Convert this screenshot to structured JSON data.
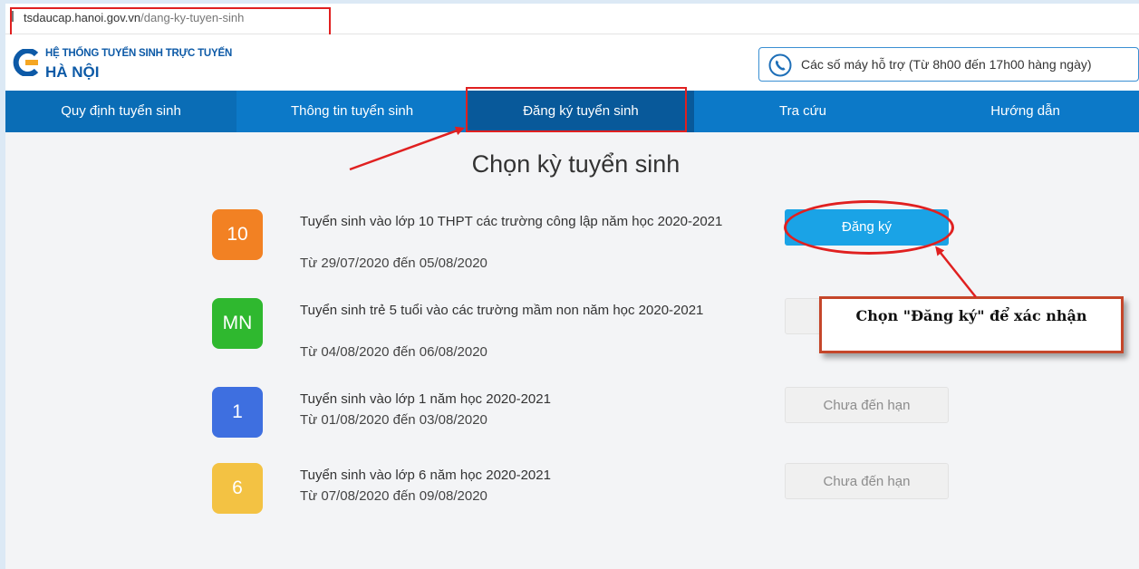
{
  "browser": {
    "url_host": "tsdaucap.hanoi.gov.vn",
    "url_path": "/dang-ky-tuyen-sinh"
  },
  "header": {
    "logo_line1": "HỆ THỐNG TUYỂN SINH TRỰC TUYẾN",
    "logo_line2": "HÀ NỘI",
    "support_text": "Các số máy hỗ trợ (Từ 8h00 đến 17h00 hàng ngày)",
    "icons": {
      "logo": "logo-icon",
      "support": "phone-icon"
    }
  },
  "nav": {
    "items": [
      {
        "label": "Quy định tuyển sinh"
      },
      {
        "label": "Thông tin tuyển sinh"
      },
      {
        "label": "Đăng ký tuyển sinh",
        "active": true
      },
      {
        "label": "Tra cứu"
      },
      {
        "label": "Hướng dẫn"
      }
    ]
  },
  "main": {
    "title": "Chọn kỳ tuyển sinh",
    "items": [
      {
        "badge": "10",
        "badge_color": "#f28123",
        "title": "Tuyển sinh vào lớp 10 THPT các trường công lập năm học 2020-2021",
        "date": "Từ 29/07/2020 đến 05/08/2020",
        "button": "Đăng ký",
        "button_state": "active"
      },
      {
        "badge": "MN",
        "badge_color": "#2fb82f",
        "title": "Tuyển sinh trẻ 5 tuổi vào các trường mầm non năm học 2020-2021",
        "date": "Từ 04/08/2020 đến 06/08/2020",
        "button": "",
        "button_state": "disabled"
      },
      {
        "badge": "1",
        "badge_color": "#3e6fe0",
        "title": "Tuyển sinh vào lớp 1 năm học 2020-2021",
        "date": "Từ 01/08/2020 đến 03/08/2020",
        "button": "Chưa đến hạn",
        "button_state": "disabled"
      },
      {
        "badge": "6",
        "badge_color": "#f3c243",
        "title": "Tuyển sinh vào lớp 6 năm học 2020-2021",
        "date": "Từ 07/08/2020 đến 09/08/2020",
        "button": "Chưa đến hạn",
        "button_state": "disabled"
      }
    ]
  },
  "annotation": {
    "callout_text": "Chọn \"Đăng ký\" để xác nhận"
  },
  "colors": {
    "brand": "#0d5aa7",
    "nav": "#0c79c8",
    "annotation": "#e02020"
  }
}
